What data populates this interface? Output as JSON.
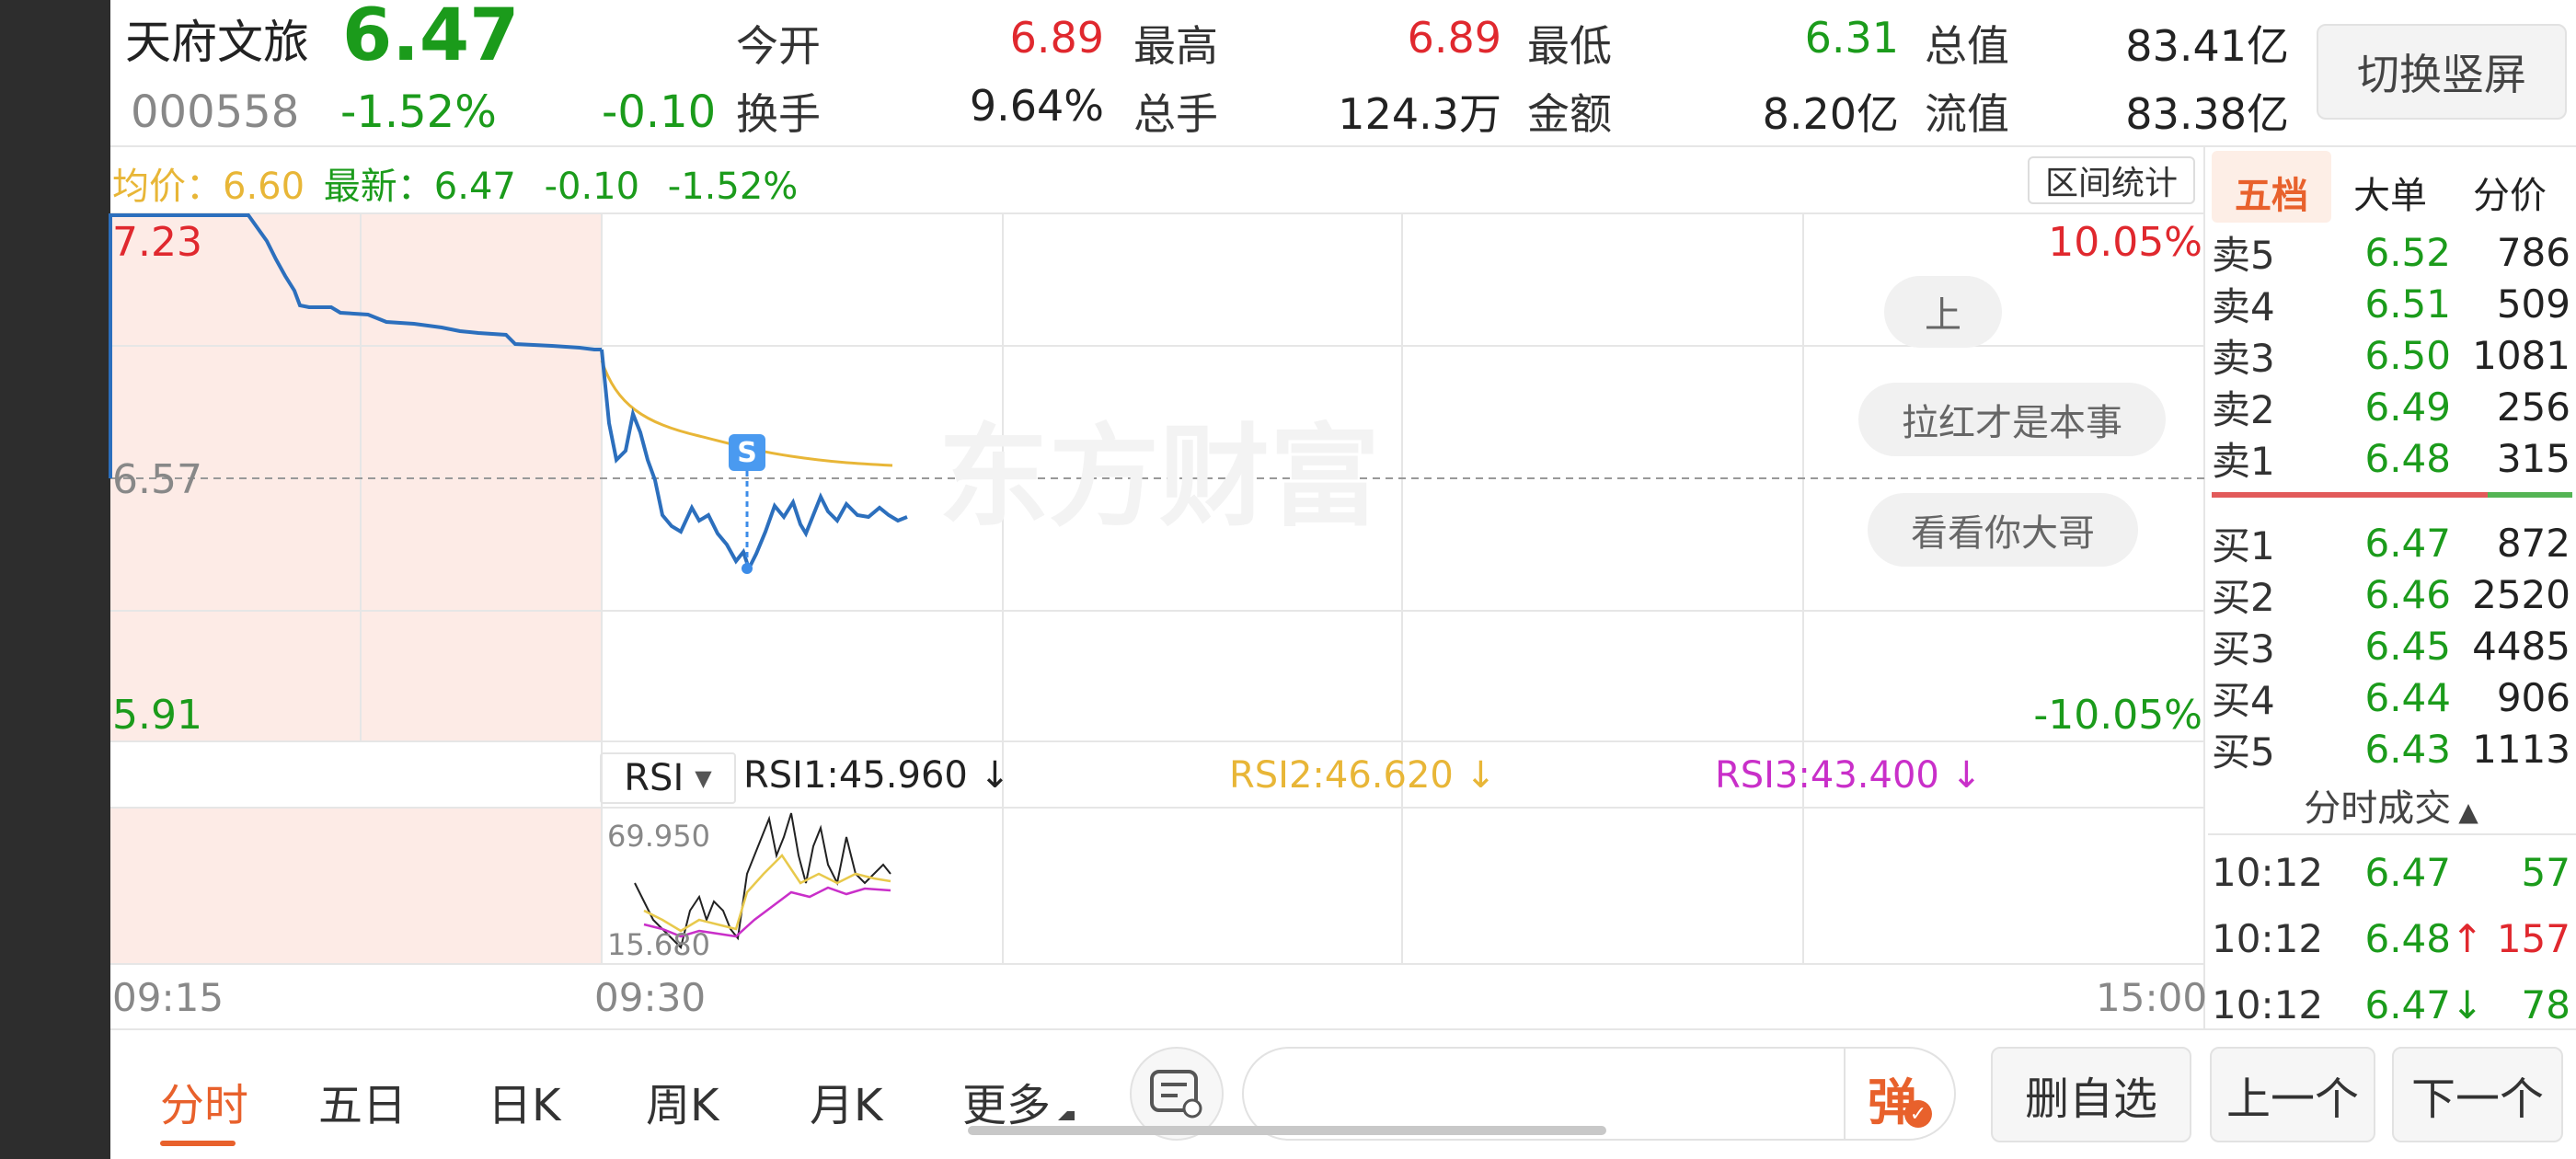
{
  "stock": {
    "name": "天府文旅",
    "price": "6.47",
    "code": "000558",
    "change_pct": "-1.52%",
    "change": "-0.10"
  },
  "quote_stats": [
    {
      "label": "今开",
      "value": "6.89",
      "color": "red"
    },
    {
      "label": "最高",
      "value": "6.89",
      "color": "red"
    },
    {
      "label": "最低",
      "value": "6.31",
      "color": "green"
    },
    {
      "label": "总值",
      "value": "83.41亿",
      "color": "black"
    },
    {
      "label": "换手",
      "value": "9.64%",
      "color": "black"
    },
    {
      "label": "总手",
      "value": "124.3万",
      "color": "black"
    },
    {
      "label": "金额",
      "value": "8.20亿",
      "color": "black"
    },
    {
      "label": "流值",
      "value": "83.38亿",
      "color": "black"
    }
  ],
  "switch_button": "切换竖屏",
  "chart_info": {
    "avg_label": "均价：",
    "avg_value": "6.60",
    "latest_label": "最新：",
    "latest_value": "6.47",
    "latest_change": "-0.10",
    "latest_pct": "-1.52%",
    "range_stats_button": "区间统计"
  },
  "price_axis": {
    "top": "7.23",
    "mid": "6.57",
    "bottom": "5.91",
    "top_pct": "10.05%",
    "bottom_pct": "-10.05%"
  },
  "watermark": "东方财富",
  "signal_badge": "S",
  "pills": [
    "上",
    "拉红才是本事",
    "看看你大哥"
  ],
  "indicator": {
    "selector": "RSI",
    "rsi1": "RSI1:45.960",
    "rsi2": "RSI2:46.620",
    "rsi3": "RSI3:43.400",
    "arrow": "↓",
    "max_label": "69.950",
    "min_label": "15.680"
  },
  "time_axis": [
    "09:15",
    "09:30",
    "15:00"
  ],
  "order_book": {
    "tabs": [
      "五档",
      "大单",
      "分价"
    ],
    "sells": [
      {
        "label": "卖5",
        "price": "6.52",
        "volume": "786"
      },
      {
        "label": "卖4",
        "price": "6.51",
        "volume": "509"
      },
      {
        "label": "卖3",
        "price": "6.50",
        "volume": "1081"
      },
      {
        "label": "卖2",
        "price": "6.49",
        "volume": "256"
      },
      {
        "label": "卖1",
        "price": "6.48",
        "volume": "315"
      }
    ],
    "buys": [
      {
        "label": "买1",
        "price": "6.47",
        "volume": "872"
      },
      {
        "label": "买2",
        "price": "6.46",
        "volume": "2520"
      },
      {
        "label": "买3",
        "price": "6.45",
        "volume": "4485"
      },
      {
        "label": "买4",
        "price": "6.44",
        "volume": "906"
      },
      {
        "label": "买5",
        "price": "6.43",
        "volume": "1113"
      }
    ]
  },
  "trades": {
    "title": "分时成交",
    "rows": [
      {
        "time": "10:12",
        "price": "6.47",
        "arrow": "",
        "volume": "57",
        "vol_color": "green"
      },
      {
        "time": "10:12",
        "price": "6.48",
        "arrow": "↑",
        "volume": "157",
        "vol_color": "red"
      },
      {
        "time": "10:12",
        "price": "6.47",
        "arrow": "↓",
        "volume": "78",
        "vol_color": "green"
      }
    ]
  },
  "tabbar": {
    "tabs": [
      "分时",
      "五日",
      "日K",
      "周K",
      "月K",
      "更多"
    ],
    "active": "分时",
    "danmu_label": "弹",
    "buttons": [
      "删自选",
      "上一个",
      "下一个"
    ]
  },
  "colors": {
    "up": "#e0282e",
    "down": "#1b9b1b",
    "line": "#2c6fbd",
    "avg": "#e8b637",
    "accent": "#e8612c"
  }
}
